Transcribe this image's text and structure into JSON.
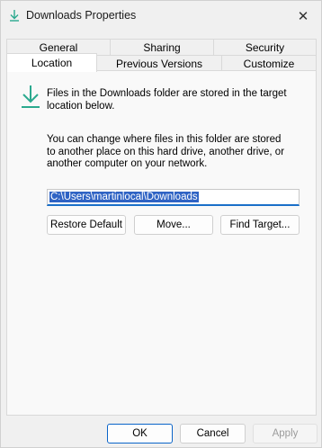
{
  "window": {
    "title": "Downloads Properties"
  },
  "tabs": {
    "row1": [
      "General",
      "Sharing",
      "Security"
    ],
    "row2": [
      "Location",
      "Previous Versions",
      "Customize"
    ],
    "active": "Location"
  },
  "location": {
    "description_1": "Files in the Downloads folder are stored in the target location below.",
    "description_2": "You can change where files in this folder are stored to another place on this hard drive, another drive, or another computer on your network.",
    "path_value": "C:\\Users\\martinlocal\\Downloads",
    "restore_default_label": "Restore Default",
    "move_label": "Move...",
    "find_target_label": "Find Target..."
  },
  "footer": {
    "ok_label": "OK",
    "cancel_label": "Cancel",
    "apply_label": "Apply"
  },
  "icons": {
    "title": "download-arrow-icon",
    "folder": "download-arrow-icon",
    "close": "close-icon"
  },
  "colors": {
    "accent": "#1a6fc9",
    "selection": "#2f63c4",
    "download_icon": "#2aa98e"
  }
}
